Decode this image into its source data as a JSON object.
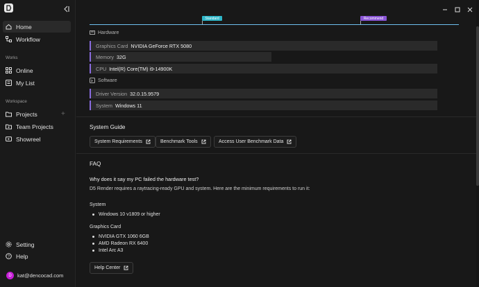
{
  "sidebar": {
    "nav": [
      {
        "label": "Home",
        "icon": "home-icon"
      },
      {
        "label": "Workflow",
        "icon": "workflow-icon"
      }
    ],
    "works_label": "Works",
    "works": [
      {
        "label": "Online",
        "icon": "grid-icon"
      },
      {
        "label": "My List",
        "icon": "list-icon"
      }
    ],
    "workspace_label": "Workspace",
    "workspace": [
      {
        "label": "Projects",
        "icon": "folder-icon"
      },
      {
        "label": "Team Projects",
        "icon": "team-icon"
      },
      {
        "label": "Showreel",
        "icon": "film-icon"
      }
    ],
    "bottom": [
      {
        "label": "Setting",
        "icon": "gear-icon"
      },
      {
        "label": "Help",
        "icon": "help-icon"
      }
    ],
    "user": {
      "initial": "D",
      "email": "kat@dencocad.com"
    }
  },
  "benchmark": {
    "standard_label": "Standard",
    "recommend_label": "Recommend"
  },
  "hardware": {
    "title": "Hardware",
    "rows": [
      {
        "key": "Graphics Card",
        "value": "NVIDIA GeForce RTX 5080"
      },
      {
        "key": "Memory",
        "value": "32G"
      },
      {
        "key": "CPU",
        "value": "Intel(R) Core(TM) i9-14900K"
      }
    ]
  },
  "software": {
    "title": "Software",
    "rows": [
      {
        "key": "Driver Version",
        "value": "32.0.15.9579"
      },
      {
        "key": "System",
        "value": "Windows 11"
      }
    ]
  },
  "guide": {
    "title": "System Guide",
    "buttons": [
      "System Requirements",
      "Benchmark Tools",
      "Access User Benchmark Data"
    ]
  },
  "faq": {
    "title": "FAQ",
    "question": "Why does it say my PC failed the hardware test?",
    "answer": "D5 Render requires a raytracing-ready GPU and system. Here are the minimum requirements to run it:",
    "system_label": "System",
    "system_items": [
      "Windows 10 v1809 or higher"
    ],
    "gpu_label": "Graphics Card",
    "gpu_items": [
      "NVIDIA GTX 1060 6GB",
      "AMD Radeon RX 6400",
      "Intel Arc A3"
    ],
    "help_button": "Help Center"
  }
}
